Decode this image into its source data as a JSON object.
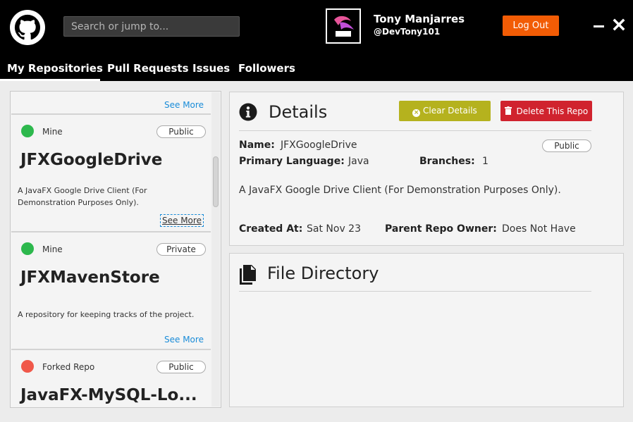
{
  "header": {
    "search_placeholder": "Search or jump to...",
    "user_name": "Tony Manjarres",
    "user_handle": "@DevTony101",
    "logout_label": "Log Out"
  },
  "nav": {
    "tabs": [
      {
        "label": "My Repositories",
        "active": true
      },
      {
        "label": "Pull Requests",
        "active": false
      },
      {
        "label": "Issues",
        "active": false
      },
      {
        "label": "Followers",
        "active": false
      }
    ]
  },
  "repo_list": {
    "top_see_more": "See More",
    "cards": [
      {
        "owner": "Mine",
        "status_color": "#2db84d",
        "visibility": "Public",
        "title": "JFXGoogleDrive",
        "description": "A JavaFX Google Drive Client (For Demonstration Purposes Only).",
        "see_more": "See More"
      },
      {
        "owner": "Mine",
        "status_color": "#2db84d",
        "visibility": "Private",
        "title": "JFXMavenStore",
        "description": "A repository for keeping tracks of the project.",
        "see_more": "See More"
      },
      {
        "owner": "Forked Repo",
        "status_color": "#f0584a",
        "visibility": "Public",
        "title": "JavaFX-MySQL-Lo...",
        "description": "",
        "see_more": ""
      }
    ]
  },
  "details": {
    "title": "Details",
    "clear_label": "Clear Details",
    "delete_label": "Delete This Repo",
    "name_label": "Name:",
    "name_value": "JFXGoogleDrive",
    "visibility": "Public",
    "language_label": "Primary Language:",
    "language_value": "Java",
    "branches_label": "Branches:",
    "branches_value": "1",
    "description": "A JavaFX Google Drive Client (For Demonstration Purposes Only).",
    "created_label": "Created At:",
    "created_value": "Sat Nov 23",
    "parent_label": "Parent Repo Owner:",
    "parent_value": "Does Not Have"
  },
  "files": {
    "title": "File Directory"
  },
  "colors": {
    "logout": "#f25c05",
    "clear": "#b5b21e",
    "delete": "#d0232e",
    "link": "#1a8cd8"
  }
}
